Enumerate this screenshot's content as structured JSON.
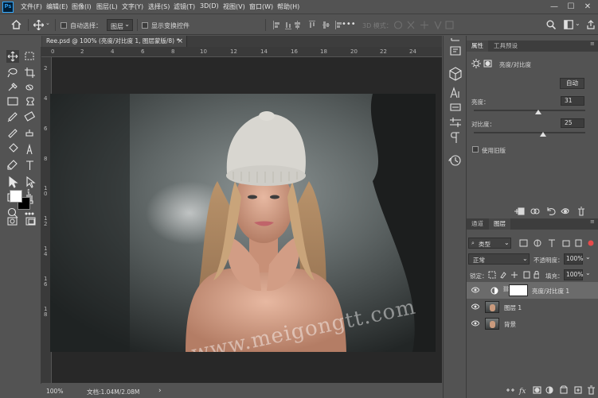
{
  "app": {
    "logo": "Ps"
  },
  "menu": [
    "文件(F)",
    "编辑(E)",
    "图像(I)",
    "图层(L)",
    "文字(Y)",
    "选择(S)",
    "滤镜(T)",
    "3D(D)",
    "视图(V)",
    "窗口(W)",
    "帮助(H)"
  ],
  "window_controls": {
    "minimize": "—",
    "maximize": "☐",
    "close": "✕"
  },
  "options_bar": {
    "auto_select_label": "自动选择：",
    "auto_select_dropdown": "图层",
    "show_transform_label": "显示变换控件",
    "mode_3d": "3D 模式：",
    "more": "•••"
  },
  "document": {
    "tab_title": "Ree.psd @ 100% (亮度/对比度 1, 图层蒙版/8) *",
    "close": "×",
    "ruler_h": [
      "0",
      "2",
      "4",
      "6",
      "8",
      "10",
      "12",
      "14",
      "16",
      "18",
      "20",
      "22",
      "24"
    ],
    "ruler_v": [
      "2",
      "4",
      "6",
      "8",
      "1\n0",
      "1\n2",
      "1\n4",
      "1\n6",
      "1\n8"
    ]
  },
  "status_bar": {
    "zoom": "100%",
    "doc_info": "文档:1.04M/2.08M",
    "arrow": "›"
  },
  "properties": {
    "tab_properties": "属性",
    "tab_tool_presets": "工具预设",
    "adjustment_title": "亮度/对比度",
    "auto_button": "自动",
    "brightness_label": "亮度：",
    "brightness_value": "31",
    "brightness_fraction": 0.58,
    "contrast_label": "对比度：",
    "contrast_value": "25",
    "contrast_fraction": 0.62,
    "use_legacy_label": "使用旧版"
  },
  "layers": {
    "tab_channels": "通道",
    "tab_layers": "图层",
    "filter_kind": "类型",
    "blend_mode": "正常",
    "opacity_label": "不透明度：",
    "opacity_value": "100%",
    "lock_label": "锁定：",
    "fill_label": "填充：",
    "fill_value": "100%",
    "items": [
      {
        "name": "亮度/对比度 1",
        "selected": true
      },
      {
        "name": "图层 1",
        "selected": false
      },
      {
        "name": "背景",
        "selected": false
      }
    ]
  },
  "watermark": "www.meigongtt.com",
  "colors": {
    "accent": "#31a8ff",
    "panel_bg": "#535353",
    "canvas_bg": "#282828"
  }
}
